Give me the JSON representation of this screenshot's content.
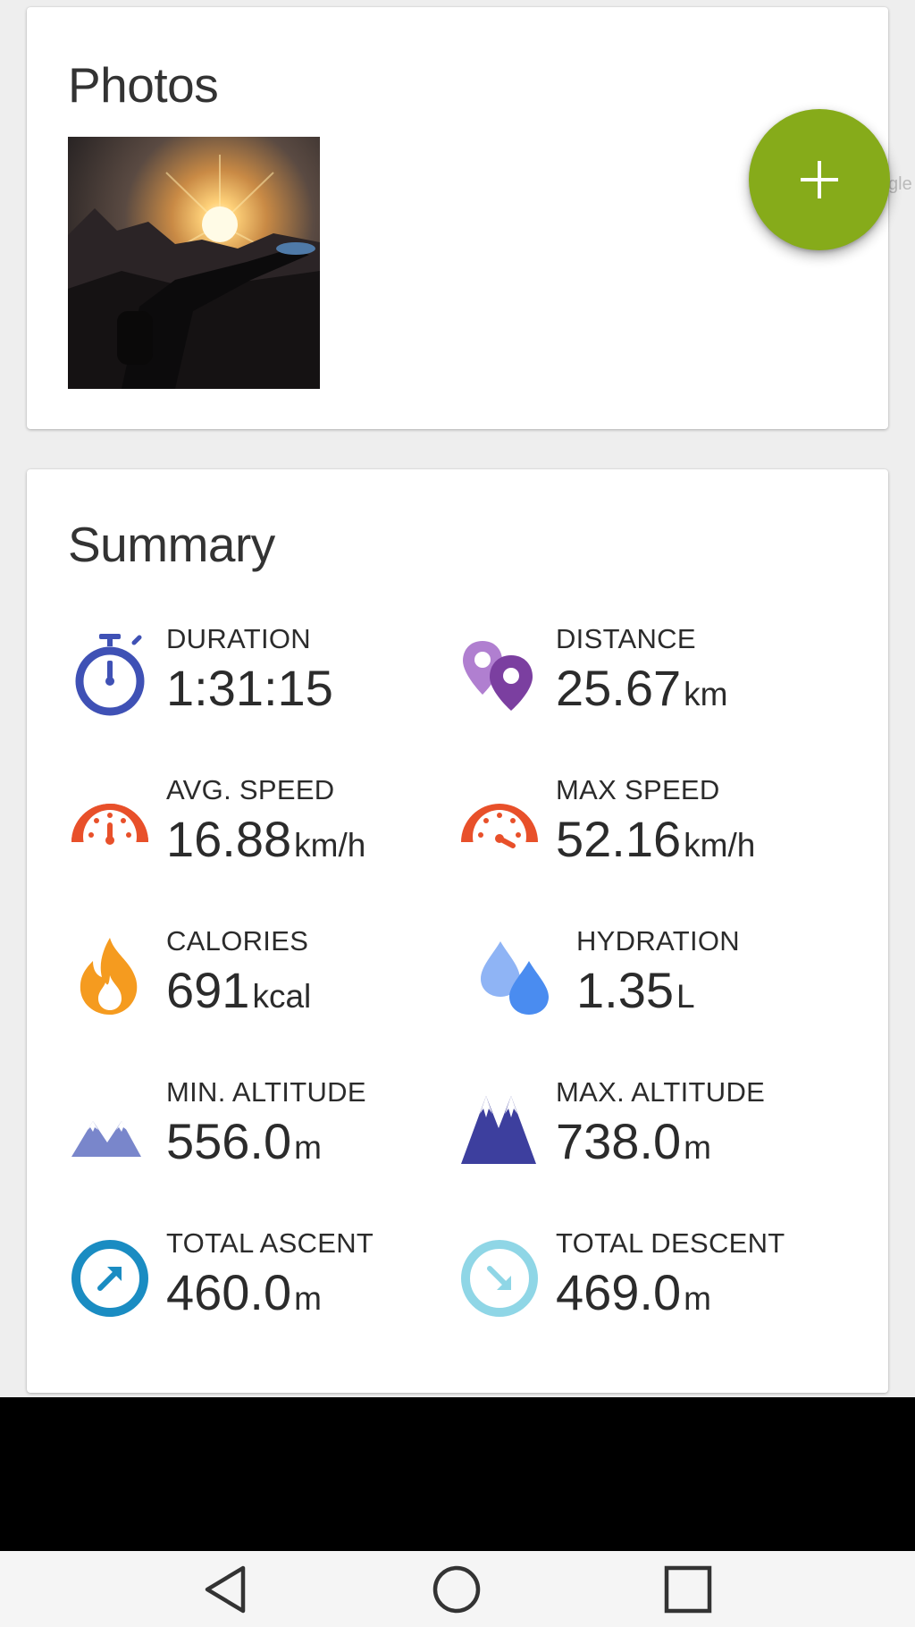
{
  "photos": {
    "title": "Photos",
    "add_button_label": "+"
  },
  "summary": {
    "title": "Summary",
    "stats": [
      {
        "label": "DURATION",
        "value": "1:31:15",
        "unit": ""
      },
      {
        "label": "DISTANCE",
        "value": "25.67",
        "unit": "km"
      },
      {
        "label": "AVG. SPEED",
        "value": "16.88",
        "unit": "km/h"
      },
      {
        "label": "MAX SPEED",
        "value": "52.16",
        "unit": "km/h"
      },
      {
        "label": "CALORIES",
        "value": "691",
        "unit": "kcal"
      },
      {
        "label": "HYDRATION",
        "value": "1.35",
        "unit": "L"
      },
      {
        "label": "MIN. ALTITUDE",
        "value": "556.0",
        "unit": "m"
      },
      {
        "label": "MAX. ALTITUDE",
        "value": "738.0",
        "unit": "m"
      },
      {
        "label": "TOTAL ASCENT",
        "value": "460.0",
        "unit": "m"
      },
      {
        "label": "TOTAL DESCENT",
        "value": "469.0",
        "unit": "m"
      }
    ]
  },
  "icons": {
    "duration": "stopwatch-icon",
    "distance": "map-pins-icon",
    "avg_speed": "speedometer-icon",
    "max_speed": "speedometer-max-icon",
    "calories": "flame-icon",
    "hydration": "water-drops-icon",
    "min_altitude": "mountains-low-icon",
    "max_altitude": "mountains-high-icon",
    "ascent": "ascent-arrow-icon",
    "descent": "descent-arrow-icon"
  },
  "colors": {
    "fab": "#86ab1a",
    "duration": "#3f51b5",
    "distance": "#7b3fa0",
    "speed": "#e8502a",
    "calories": "#f59b1f",
    "hydration": "#4a8cf0",
    "altitude_low": "#7986cb",
    "altitude_high": "#3d3f9e",
    "ascent": "#1a8cc2",
    "descent": "#8fd6e6"
  },
  "navigation": {
    "back": "back-icon",
    "home": "home-icon",
    "recents": "recents-icon"
  }
}
